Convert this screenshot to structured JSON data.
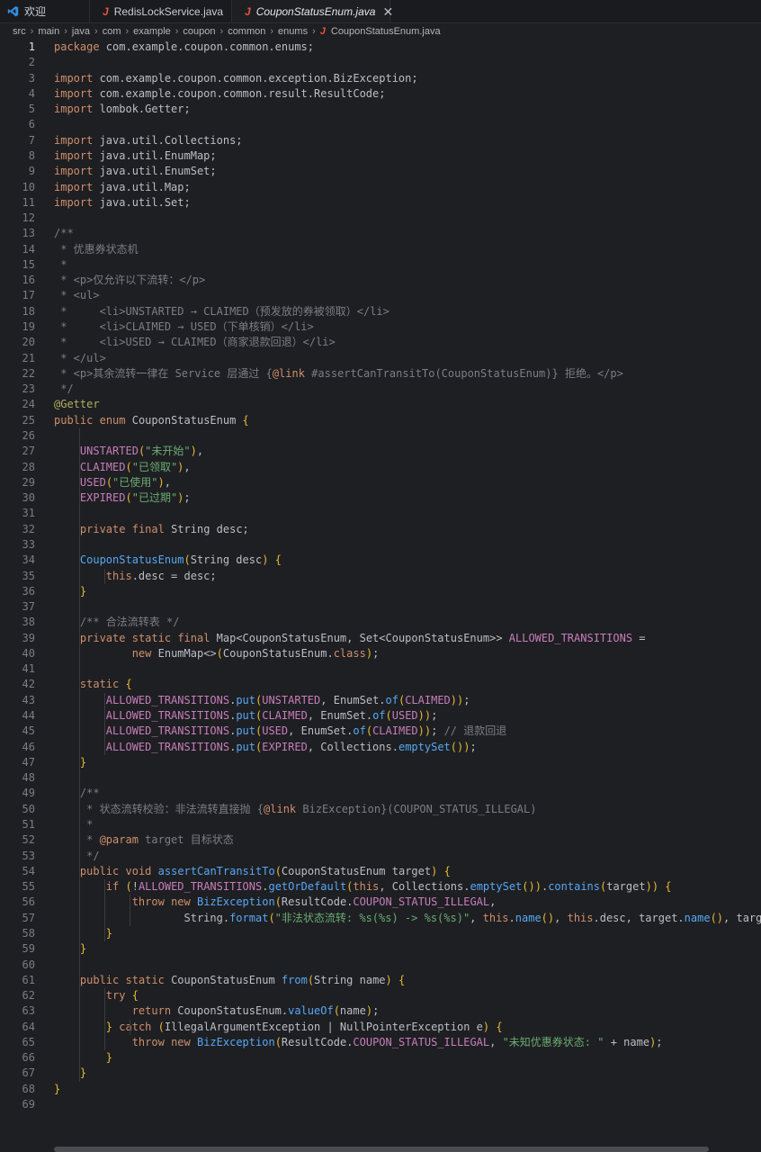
{
  "tabs": [
    {
      "label": "欢迎",
      "icon": "vscode-icon"
    },
    {
      "label": "RedisLockService.java",
      "icon": "java-file-icon"
    },
    {
      "label": "CouponStatusEnum.java",
      "icon": "java-file-icon",
      "active": true
    }
  ],
  "breadcrumb": [
    "src",
    "main",
    "java",
    "com",
    "example",
    "coupon",
    "common",
    "enums"
  ],
  "breadcrumb_file": "CouponStatusEnum.java",
  "current_line": 1,
  "colors": {
    "background": "#1e1f22",
    "keyword": "#cf8e6d",
    "string": "#6aab73",
    "comment": "#7a7e85",
    "annotation": "#b3ae60",
    "enum_constant": "#c77dbb",
    "method": "#56a8f5"
  },
  "lines": [
    "package com.example.coupon.common.enums;",
    "",
    "import com.example.coupon.common.exception.BizException;",
    "import com.example.coupon.common.result.ResultCode;",
    "import lombok.Getter;",
    "",
    "import java.util.Collections;",
    "import java.util.EnumMap;",
    "import java.util.EnumSet;",
    "import java.util.Map;",
    "import java.util.Set;",
    "",
    "/**",
    " * 优惠券状态机",
    " *",
    " * <p>仅允许以下流转：</p>",
    " * <ul>",
    " *     <li>UNSTARTED → CLAIMED（预发放的券被领取）</li>",
    " *     <li>CLAIMED → USED（下单核销）</li>",
    " *     <li>USED → CLAIMED（商家退款回退）</li>",
    " * </ul>",
    " * <p>其余流转一律在 Service 层通过 {@link #assertCanTransitTo(CouponStatusEnum)} 拒绝。</p>",
    " */",
    "@Getter",
    "public enum CouponStatusEnum {",
    "",
    "    UNSTARTED(\"未开始\"),",
    "    CLAIMED(\"已领取\"),",
    "    USED(\"已使用\"),",
    "    EXPIRED(\"已过期\");",
    "",
    "    private final String desc;",
    "",
    "    CouponStatusEnum(String desc) {",
    "        this.desc = desc;",
    "    }",
    "",
    "    /** 合法流转表 */",
    "    private static final Map<CouponStatusEnum, Set<CouponStatusEnum>> ALLOWED_TRANSITIONS =",
    "            new EnumMap<>(CouponStatusEnum.class);",
    "",
    "    static {",
    "        ALLOWED_TRANSITIONS.put(UNSTARTED, EnumSet.of(CLAIMED));",
    "        ALLOWED_TRANSITIONS.put(CLAIMED, EnumSet.of(USED));",
    "        ALLOWED_TRANSITIONS.put(USED, EnumSet.of(CLAIMED)); // 退款回退",
    "        ALLOWED_TRANSITIONS.put(EXPIRED, Collections.emptySet());",
    "    }",
    "",
    "    /**",
    "     * 状态流转校验：非法流转直接抛 {@link BizException}(COUPON_STATUS_ILLEGAL)",
    "     *",
    "     * @param target 目标状态",
    "     */",
    "    public void assertCanTransitTo(CouponStatusEnum target) {",
    "        if (!ALLOWED_TRANSITIONS.getOrDefault(this, Collections.emptySet()).contains(target)) {",
    "            throw new BizException(ResultCode.COUPON_STATUS_ILLEGAL,",
    "                    String.format(\"非法状态流转: %s(%s) -> %s(%s)\", this.name(), this.desc, target.name(), target.desc));",
    "        }",
    "    }",
    "",
    "    public static CouponStatusEnum from(String name) {",
    "        try {",
    "            return CouponStatusEnum.valueOf(name);",
    "        } catch (IllegalArgumentException | NullPointerException e) {",
    "            throw new BizException(ResultCode.COUPON_STATUS_ILLEGAL, \"未知优惠券状态: \" + name);",
    "        }",
    "    }",
    "}",
    ""
  ]
}
